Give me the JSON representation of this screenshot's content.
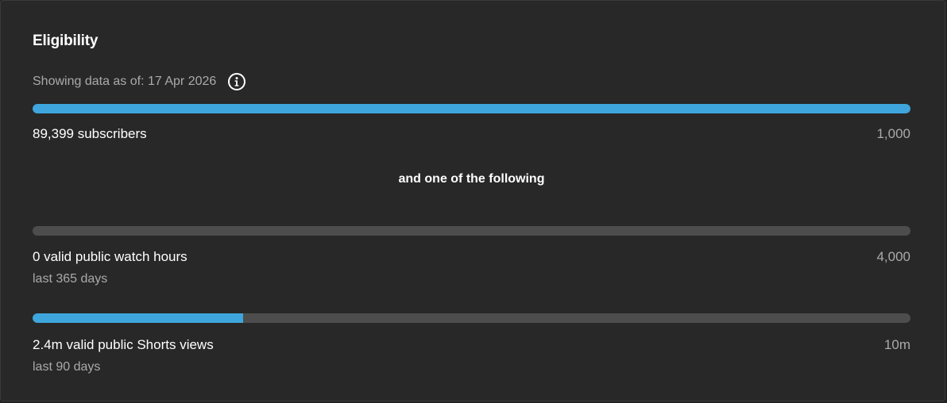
{
  "card": {
    "title": "Eligibility",
    "as_of": "Showing data as of: 17 Apr 2026",
    "info_icon": "info-circle-icon",
    "separator": "and one of the following"
  },
  "colors": {
    "background": "#282828",
    "progress_fill": "#3ea6dc",
    "progress_track": "#4d4d4d",
    "secondary_text": "#aaaaaa"
  },
  "metrics": [
    {
      "label": "89,399 subscribers",
      "target": "1,000",
      "sublabel": "",
      "progress": 1.0
    },
    {
      "label": "0 valid public watch hours",
      "target": "4,000",
      "sublabel": "last 365 days",
      "progress": 0.0
    },
    {
      "label": "2.4m valid public Shorts views",
      "target": "10m",
      "sublabel": "last 90 days",
      "progress": 0.24
    }
  ]
}
